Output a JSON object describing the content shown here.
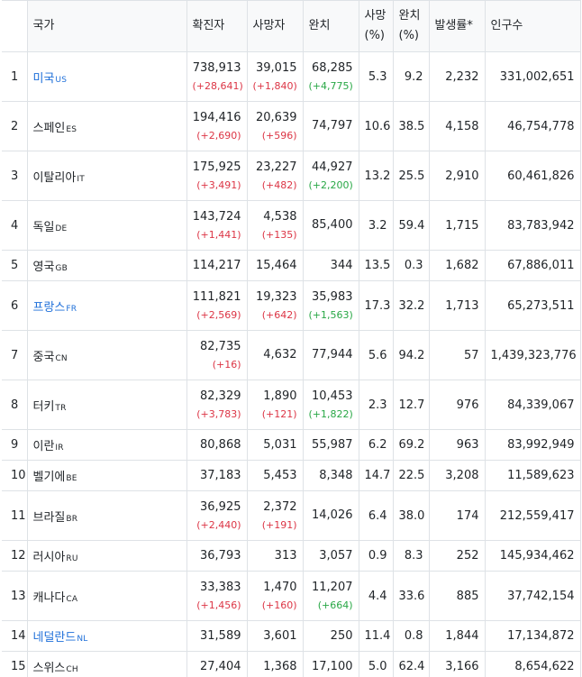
{
  "headers": {
    "country": "국가",
    "confirmed": "확진자",
    "deaths": "사망자",
    "recovered": "완치",
    "death_rate_line1": "사망",
    "death_rate_line2": "(%)",
    "recovery_rate_line1": "완치",
    "recovery_rate_line2": "(%)",
    "incidence": "발생률*",
    "population": "인구수"
  },
  "colors": {
    "link": "#1e6fd9",
    "increase_red": "#dc3545",
    "recovered_green": "#28a745",
    "header_bg": "#f8f9fa",
    "border": "#dee2e6"
  },
  "rows": [
    {
      "rank": "1",
      "name": "미국",
      "code": "US",
      "link": true,
      "confirmed": "738,913",
      "confirmed_delta": "(+28,641)",
      "deaths": "39,015",
      "deaths_delta": "(+1,840)",
      "recovered": "68,285",
      "recovered_delta": "(+4,775)",
      "death_rate": "5.3",
      "recovery_rate": "9.2",
      "incidence": "2,232",
      "population": "331,002,651"
    },
    {
      "rank": "2",
      "name": "스페인",
      "code": "ES",
      "link": false,
      "confirmed": "194,416",
      "confirmed_delta": "(+2,690)",
      "deaths": "20,639",
      "deaths_delta": "(+596)",
      "recovered": "74,797",
      "recovered_delta": "",
      "death_rate": "10.6",
      "recovery_rate": "38.5",
      "incidence": "4,158",
      "population": "46,754,778"
    },
    {
      "rank": "3",
      "name": "이탈리아",
      "code": "IT",
      "link": false,
      "confirmed": "175,925",
      "confirmed_delta": "(+3,491)",
      "deaths": "23,227",
      "deaths_delta": "(+482)",
      "recovered": "44,927",
      "recovered_delta": "(+2,200)",
      "death_rate": "13.2",
      "recovery_rate": "25.5",
      "incidence": "2,910",
      "population": "60,461,826"
    },
    {
      "rank": "4",
      "name": "독일",
      "code": "DE",
      "link": false,
      "confirmed": "143,724",
      "confirmed_delta": "(+1,441)",
      "deaths": "4,538",
      "deaths_delta": "(+135)",
      "recovered": "85,400",
      "recovered_delta": "",
      "death_rate": "3.2",
      "recovery_rate": "59.4",
      "incidence": "1,715",
      "population": "83,783,942"
    },
    {
      "rank": "5",
      "name": "영국",
      "code": "GB",
      "link": false,
      "confirmed": "114,217",
      "confirmed_delta": "",
      "deaths": "15,464",
      "deaths_delta": "",
      "recovered": "344",
      "recovered_delta": "",
      "death_rate": "13.5",
      "recovery_rate": "0.3",
      "incidence": "1,682",
      "population": "67,886,011"
    },
    {
      "rank": "6",
      "name": "프랑스",
      "code": "FR",
      "link": true,
      "confirmed": "111,821",
      "confirmed_delta": "(+2,569)",
      "deaths": "19,323",
      "deaths_delta": "(+642)",
      "recovered": "35,983",
      "recovered_delta": "(+1,563)",
      "death_rate": "17.3",
      "recovery_rate": "32.2",
      "incidence": "1,713",
      "population": "65,273,511"
    },
    {
      "rank": "7",
      "name": "중국",
      "code": "CN",
      "link": false,
      "confirmed": "82,735",
      "confirmed_delta": "(+16)",
      "deaths": "4,632",
      "deaths_delta": "",
      "recovered": "77,944",
      "recovered_delta": "",
      "death_rate": "5.6",
      "recovery_rate": "94.2",
      "incidence": "57",
      "population": "1,439,323,776"
    },
    {
      "rank": "8",
      "name": "터키",
      "code": "TR",
      "link": false,
      "confirmed": "82,329",
      "confirmed_delta": "(+3,783)",
      "deaths": "1,890",
      "deaths_delta": "(+121)",
      "recovered": "10,453",
      "recovered_delta": "(+1,822)",
      "death_rate": "2.3",
      "recovery_rate": "12.7",
      "incidence": "976",
      "population": "84,339,067"
    },
    {
      "rank": "9",
      "name": "이란",
      "code": "IR",
      "link": false,
      "confirmed": "80,868",
      "confirmed_delta": "",
      "deaths": "5,031",
      "deaths_delta": "",
      "recovered": "55,987",
      "recovered_delta": "",
      "death_rate": "6.2",
      "recovery_rate": "69.2",
      "incidence": "963",
      "population": "83,992,949"
    },
    {
      "rank": "10",
      "name": "벨기에",
      "code": "BE",
      "link": false,
      "confirmed": "37,183",
      "confirmed_delta": "",
      "deaths": "5,453",
      "deaths_delta": "",
      "recovered": "8,348",
      "recovered_delta": "",
      "death_rate": "14.7",
      "recovery_rate": "22.5",
      "incidence": "3,208",
      "population": "11,589,623"
    },
    {
      "rank": "11",
      "name": "브라질",
      "code": "BR",
      "link": false,
      "confirmed": "36,925",
      "confirmed_delta": "(+2,440)",
      "deaths": "2,372",
      "deaths_delta": "(+191)",
      "recovered": "14,026",
      "recovered_delta": "",
      "death_rate": "6.4",
      "recovery_rate": "38.0",
      "incidence": "174",
      "population": "212,559,417"
    },
    {
      "rank": "12",
      "name": "러시아",
      "code": "RU",
      "link": false,
      "confirmed": "36,793",
      "confirmed_delta": "",
      "deaths": "313",
      "deaths_delta": "",
      "recovered": "3,057",
      "recovered_delta": "",
      "death_rate": "0.9",
      "recovery_rate": "8.3",
      "incidence": "252",
      "population": "145,934,462"
    },
    {
      "rank": "13",
      "name": "캐나다",
      "code": "CA",
      "link": false,
      "confirmed": "33,383",
      "confirmed_delta": "(+1,456)",
      "deaths": "1,470",
      "deaths_delta": "(+160)",
      "recovered": "11,207",
      "recovered_delta": "(+664)",
      "death_rate": "4.4",
      "recovery_rate": "33.6",
      "incidence": "885",
      "population": "37,742,154"
    },
    {
      "rank": "14",
      "name": "네덜란드",
      "code": "NL",
      "link": true,
      "confirmed": "31,589",
      "confirmed_delta": "",
      "deaths": "3,601",
      "deaths_delta": "",
      "recovered": "250",
      "recovered_delta": "",
      "death_rate": "11.4",
      "recovery_rate": "0.8",
      "incidence": "1,844",
      "population": "17,134,872"
    },
    {
      "rank": "15",
      "name": "스위스",
      "code": "CH",
      "link": false,
      "confirmed": "27,404",
      "confirmed_delta": "",
      "deaths": "1,368",
      "deaths_delta": "",
      "recovered": "17,100",
      "recovered_delta": "",
      "death_rate": "5.0",
      "recovery_rate": "62.4",
      "incidence": "3,166",
      "population": "8,654,622"
    }
  ]
}
